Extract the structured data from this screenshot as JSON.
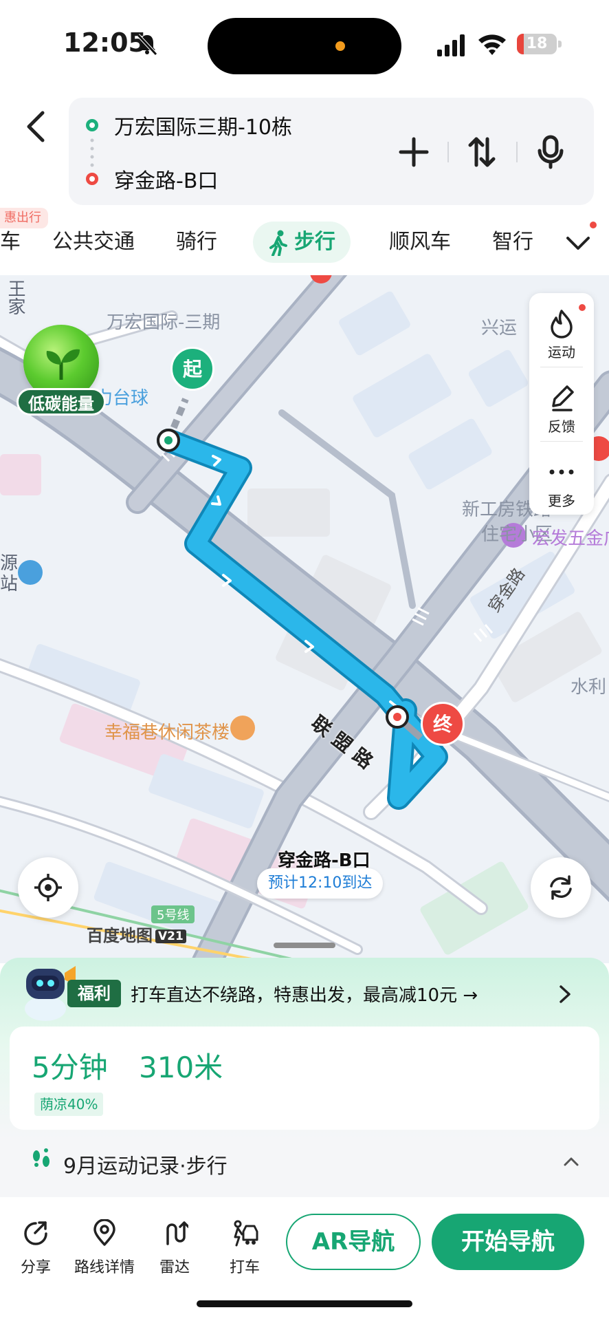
{
  "status_bar": {
    "time": "12:05",
    "battery": "18",
    "battery_level": 0.18
  },
  "route": {
    "start": "万宏国际三期-10栋",
    "end": "穿金路-B口"
  },
  "tabs": {
    "promo_badge": "惠出行",
    "items": [
      {
        "label": "车",
        "active": false
      },
      {
        "label": "公共交通",
        "active": false
      },
      {
        "label": "骑行",
        "active": false
      },
      {
        "label": "步行",
        "active": true
      },
      {
        "label": "顺风车",
        "active": false
      },
      {
        "label": "智行",
        "active": false
      }
    ]
  },
  "map": {
    "labels": {
      "building_top": "万宏国际-三期",
      "side_vertical": "王家",
      "xingyun": "兴运",
      "laili": "来力台球",
      "xingong": "新工房铁路",
      "xingong2": "住宅小区",
      "hongfa": "宏发五金广",
      "shuili": "水利",
      "left_source": "源",
      "left_station": "站",
      "tea": "幸福巷休闲茶楼",
      "metro": "5号线",
      "road_lianmeng": "联盟路",
      "road_chuanjin": "穿金路"
    },
    "eco_label": "低碳能量",
    "start_pin": "起",
    "end_pin": "终",
    "end_name": "穿金路-B口",
    "eta": "预计12:10到达",
    "brand": "百度地图",
    "brand_version": "V21",
    "side_panel": {
      "exercise": "运动",
      "feedback": "反馈",
      "more": "更多"
    }
  },
  "promo": {
    "tag": "福利",
    "text": "打车直达不绕路，特惠出发，最高减10元 →"
  },
  "summary": {
    "time": "5分钟",
    "distance": "310米",
    "shade": "荫凉40%"
  },
  "exercise_record": "9月运动记录·步行",
  "bottom_bar": {
    "share": "分享",
    "route_detail": "路线详情",
    "radar": "雷达",
    "taxi": "打车",
    "ar_nav": "AR导航",
    "start_nav": "开始导航"
  },
  "colors": {
    "accent": "#17a673",
    "route": "#2bb7ea",
    "end_red": "#ee4a43",
    "start_green": "#1cb07c"
  }
}
